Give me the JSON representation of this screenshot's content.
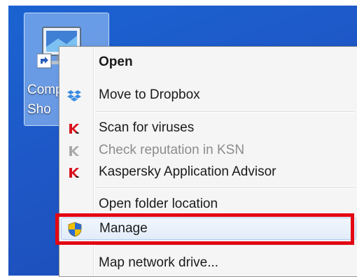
{
  "desktop": {
    "icon_label_line1": "Comp",
    "icon_label_line2": "Sho",
    "icon_name": "computer-icon"
  },
  "context_menu": {
    "items": [
      {
        "label": "Open",
        "icon": null,
        "style": "bold"
      },
      {
        "label": "Move to Dropbox",
        "icon": "dropbox-icon"
      },
      {
        "label": "Scan for viruses",
        "icon": "kaspersky-icon"
      },
      {
        "label": "Check reputation in KSN",
        "icon": "kaspersky-gray-icon",
        "disabled": true
      },
      {
        "label": "Kaspersky Application Advisor",
        "icon": "kaspersky-icon"
      },
      {
        "label": "Open folder location",
        "icon": null
      },
      {
        "label": "Manage",
        "icon": "shield-icon",
        "highlighted": true
      },
      {
        "label": "Map network drive...",
        "icon": null
      }
    ]
  },
  "colors": {
    "desktop_blue": "#1f57c6",
    "highlight_red": "#e30613",
    "kaspersky_red": "#d8141e",
    "dropbox_blue": "#3d8ce0"
  }
}
